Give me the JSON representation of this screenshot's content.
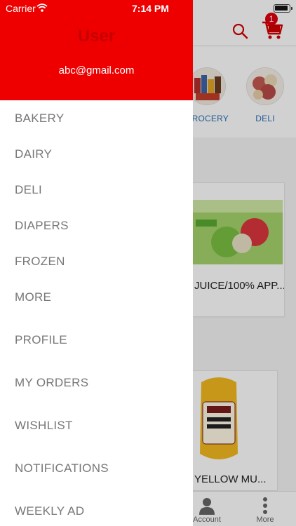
{
  "status_bar": {
    "carrier": "Carrier",
    "time": "7:14 PM"
  },
  "header": {
    "cart_count": "1"
  },
  "categories": [
    {
      "label": "GROCERY"
    },
    {
      "label": "DELI"
    }
  ],
  "products": [
    {
      "title": "JUICE/100% APP..."
    },
    {
      "title": "YELLOW MU..."
    }
  ],
  "tab_bar": [
    {
      "label": "Account",
      "icon": "person-icon"
    },
    {
      "label": "More",
      "icon": "more-vertical-icon"
    }
  ],
  "drawer": {
    "user": "User",
    "email": "abc@gmail.com",
    "items": [
      {
        "label": "BAKERY"
      },
      {
        "label": "DAIRY"
      },
      {
        "label": "DELI"
      },
      {
        "label": "DIAPERS"
      },
      {
        "label": "FROZEN"
      },
      {
        "label": "MORE"
      },
      {
        "label": "PROFILE"
      },
      {
        "label": "MY ORDERS"
      },
      {
        "label": "WISHLIST"
      },
      {
        "label": "NOTIFICATIONS"
      },
      {
        "label": "WEEKLY AD"
      }
    ]
  },
  "colors": {
    "brand_red": "#ee0000",
    "link_blue": "#2a6fb5",
    "menu_text": "#777777"
  }
}
